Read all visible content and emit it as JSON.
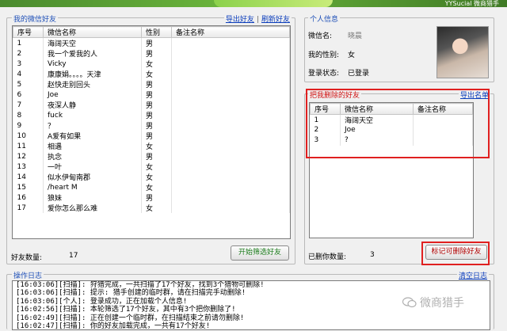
{
  "banner": {
    "right_text": "YYSucial 微商猎手"
  },
  "friends": {
    "title": "我的微信好友",
    "export_link": "导出好友",
    "refresh_link": "刷新好友",
    "columns": [
      "序号",
      "微信名称",
      "性别",
      "备注名称"
    ],
    "rows": [
      {
        "no": "1",
        "name": "海阔天空",
        "gender": "男",
        "remark": ""
      },
      {
        "no": "2",
        "name": "我一个爱我的人",
        "gender": "男",
        "remark": ""
      },
      {
        "no": "3",
        "name": "Vicky",
        "gender": "女",
        "remark": ""
      },
      {
        "no": "4",
        "name": "康康娟。。。。天津",
        "gender": "女",
        "remark": ""
      },
      {
        "no": "5",
        "name": "赵快走别回头",
        "gender": "男",
        "remark": ""
      },
      {
        "no": "6",
        "name": "Joe",
        "gender": "男",
        "remark": ""
      },
      {
        "no": "7",
        "name": "夜深人静",
        "gender": "男",
        "remark": ""
      },
      {
        "no": "8",
        "name": "fuck",
        "gender": "男",
        "remark": ""
      },
      {
        "no": "9",
        "name": "？",
        "gender": "男",
        "remark": ""
      },
      {
        "no": "10",
        "name": "A爱有如果",
        "gender": "男",
        "remark": ""
      },
      {
        "no": "11",
        "name": "相遇",
        "gender": "女",
        "remark": ""
      },
      {
        "no": "12",
        "name": "执念",
        "gender": "男",
        "remark": ""
      },
      {
        "no": "13",
        "name": "一叶",
        "gender": "女",
        "remark": ""
      },
      {
        "no": "14",
        "name": "似水伊甸南郡",
        "gender": "女",
        "remark": ""
      },
      {
        "no": "15",
        "name": "/heart M",
        "gender": "女",
        "remark": ""
      },
      {
        "no": "16",
        "name": "狼妹",
        "gender": "男",
        "remark": ""
      },
      {
        "no": "17",
        "name": "爱你怎么那么难",
        "gender": "女",
        "remark": ""
      }
    ],
    "count_label": "好友数量:",
    "count_value": "17",
    "scan_button": "开始筛选好友"
  },
  "personal": {
    "title": "个人信息",
    "wechat_name_label": "微信名:",
    "wechat_name_value": "晓晨",
    "gender_label": "我的性别:",
    "gender_value": "女",
    "login_label": "登录状态:",
    "login_value": "已登录"
  },
  "deleted": {
    "title": "把我删除的好友",
    "export_link": "导出名单",
    "columns": [
      "序号",
      "微信名称",
      "备注名称"
    ],
    "rows": [
      {
        "no": "1",
        "name": "海阔天空",
        "remark": ""
      },
      {
        "no": "2",
        "name": "Joe",
        "remark": ""
      },
      {
        "no": "3",
        "name": "?",
        "remark": ""
      }
    ],
    "count_label": "已删你数量:",
    "count_value": "3",
    "mark_button": "标记可删除好友"
  },
  "log": {
    "title": "操作日志",
    "clear_link": "清空日志",
    "lines": [
      "[16:03:06][扫描]: 狩猎完成，一共扫描了17个好友，找到3个猎物可删除!",
      "[16:03:06][扫描]: 提示: 猎手创建的临时群，请在扫描完手动删除!",
      "[16:03:06][个人]: 登录成功，正在加载个人信息!",
      "[16:02:56][扫描]: 本轮筛选了17个好友，其中有3个把你删除了!",
      "[16:02:49][扫描]: 正在创建一个临时群，在扫描结束之前请勿删除!",
      "[16:02:47][扫描]: 你的好友加载完成，一共有17个好友!"
    ]
  },
  "watermark": {
    "text": "微商猎手"
  }
}
